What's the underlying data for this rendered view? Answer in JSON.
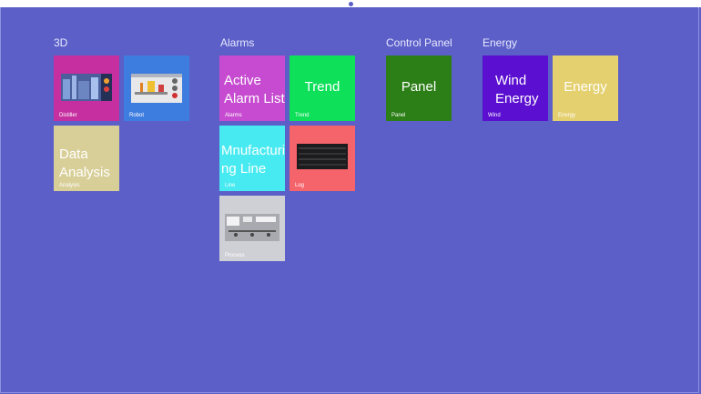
{
  "groups": {
    "g3d": "3D",
    "alarms": "Alarms",
    "control": "Control Panel",
    "energy": "Energy"
  },
  "tiles": {
    "distiller": {
      "caption": "Distiller",
      "color": "#c62f9f"
    },
    "robot": {
      "caption": "Robot",
      "color": "#3e7de0"
    },
    "analysis": {
      "title_line1": "Data",
      "title_line2": "Analysis",
      "caption": "Analysis",
      "color": "#d8cf98"
    },
    "alarms": {
      "title_line1": "Active",
      "title_line2": "Alarm List",
      "caption": "Alarms",
      "color": "#c64bd0"
    },
    "trend": {
      "title": "Trend",
      "caption": "Trend",
      "color": "#0ee05a"
    },
    "line": {
      "title_line1": "Mnufacturi",
      "title_line2": "ng Line",
      "caption": "Line",
      "color": "#46eaf0"
    },
    "log": {
      "caption": "Log",
      "color": "#f5636b"
    },
    "process": {
      "caption": "Process",
      "color": "#cfcfd6"
    },
    "panel": {
      "title": "Panel",
      "caption": "Panel",
      "color": "#2c7e17"
    },
    "wind": {
      "title_line1": "Wind",
      "title_line2": "Energy",
      "caption": "Wind",
      "color": "#5b0fd0"
    },
    "energy": {
      "title": "Energy",
      "caption": "Energy",
      "color": "#e5d06f"
    }
  }
}
